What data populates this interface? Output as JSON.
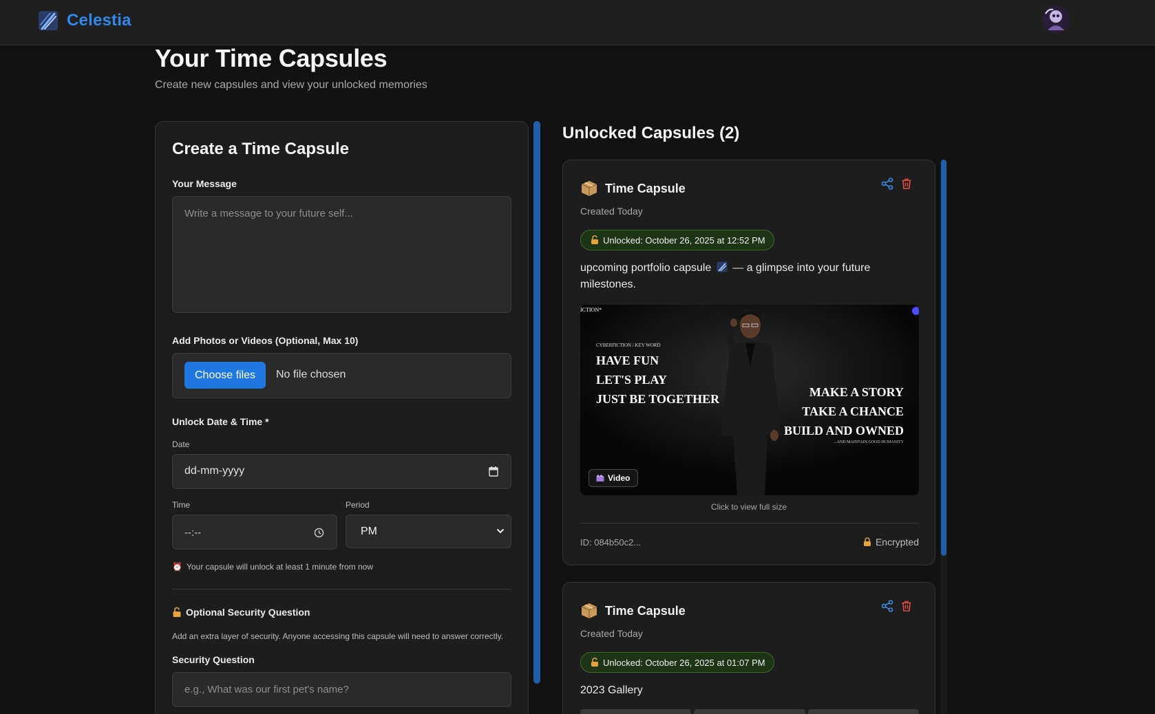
{
  "app": {
    "name": "Celestia",
    "icons": {
      "logo": "meteor-logo-icon",
      "avatar": "user-avatar"
    }
  },
  "page": {
    "title": "Your Time Capsules",
    "subtitle": "Create new capsules and view your unlocked memories"
  },
  "create_form": {
    "title": "Create a Time Capsule",
    "message_label": "Your Message",
    "message_placeholder": "Write a message to your future self...",
    "media_label": "Add Photos or Videos (Optional, Max 10)",
    "choose_files_label": "Choose files",
    "file_status": "No file chosen",
    "unlock_label": "Unlock Date & Time *",
    "date_label": "Date",
    "date_value": "dd-mm-yyyy",
    "time_label": "Time",
    "time_value": "--:--",
    "period_label": "Period",
    "period_value": "PM",
    "hint": "Your capsule will unlock at least 1 minute from now",
    "security_label": "Optional Security Question",
    "security_desc": "Add an extra layer of security. Anyone accessing this capsule will need to answer correctly.",
    "question_label": "Security Question",
    "question_placeholder": "e.g., What was our first pet's name?"
  },
  "unlocked": {
    "title": "Unlocked Capsules (2)",
    "capsules": [
      {
        "title": "Time Capsule",
        "created": "Created Today",
        "unlocked": "Unlocked: October 26, 2025 at 12:52 PM",
        "message_before": "upcoming portfolio capsule",
        "message_after": "— a glimpse into your future milestones.",
        "media": {
          "corner_text": "ICTION*",
          "small_heading": "CYBERFICTION / KEY WORD",
          "left_lines": [
            "HAVE FUN",
            "LET'S PLAY",
            "JUST BE TOGETHER"
          ],
          "right_lines": [
            "MAKE A STORY",
            "TAKE A CHANCE",
            "BUILD AND OWNED"
          ],
          "right_small": "...AND MAINTAIN GOOD HUMANITY",
          "chip": "Video"
        },
        "click_hint": "Click to view full size",
        "id": "ID: 084b50c2...",
        "encrypted": "Encrypted"
      },
      {
        "title": "Time Capsule",
        "created": "Created Today",
        "unlocked": "Unlocked: October 26, 2025 at 01:07 PM",
        "message": "2023 Gallery"
      }
    ]
  },
  "colors": {
    "accent": "#1e78e0",
    "brand": "#2f88ea",
    "background": "#121212",
    "card": "#1d1d1d",
    "badge_green": "#1c3514",
    "delete_red": "#e0504a"
  }
}
